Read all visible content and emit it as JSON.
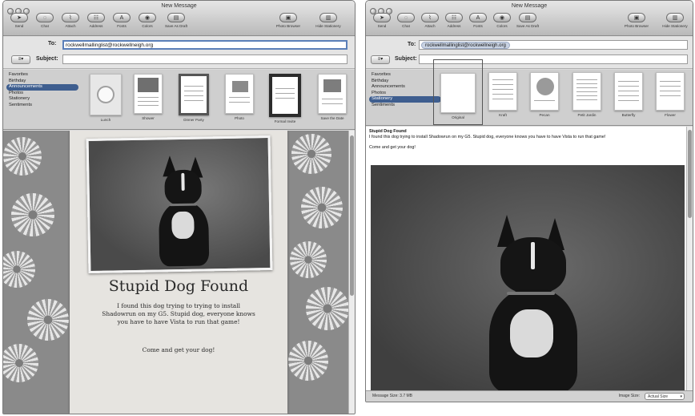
{
  "left": {
    "title": "New Message",
    "toolbar": [
      "Send",
      "Chat",
      "Attach",
      "Address",
      "Fonts",
      "Colors",
      "Save As Draft",
      "Photo Browser",
      "Hide Stationery"
    ],
    "to": "rockwellmallinglist@rockwellneigh.org",
    "to_label": "To:",
    "subject_label": "Subject:",
    "subject": "",
    "categories": [
      "Favorites",
      "Birthday",
      "Announcements",
      "Photos",
      "Stationery",
      "Sentiments"
    ],
    "selected_category": 2,
    "templates": [
      "Lunch",
      "Shower",
      "Dinner Party",
      "Photo",
      "Formal Invite",
      "Save the Date"
    ],
    "letter": {
      "title": "Stupid Dog Found",
      "body": "I found this dog trying to trying to install Shadowrun on my G5. Stupid dog, everyone knows you have to have Vista to run that game!",
      "sign": "Come and get your dog!"
    }
  },
  "right": {
    "title": "New Message",
    "toolbar": [
      "Send",
      "Chat",
      "Attach",
      "Address",
      "Fonts",
      "Colors",
      "Save As Draft",
      "Photo Browser",
      "Hide Stationery"
    ],
    "to": "rockwellmallinglist@rockwellneigh.org",
    "to_label": "To:",
    "subject_label": "Subject:",
    "categories": [
      "Favorites",
      "Birthday",
      "Announcements",
      "Photos",
      "Stationery",
      "Sentiments"
    ],
    "selected_category": 4,
    "templates": [
      "Original",
      "Kraft",
      "Pecan",
      "Petit Jardin",
      "Butterfly",
      "Flower"
    ],
    "body_title": "Stupid Dog Found",
    "body_text": "I found this dog trying to install Shadowrun on my G5. Stupid dog, everyone knows you have to have Vista to run that game!",
    "body_sign": "Come and get your dog!",
    "message_size_label": "Message Size: 3.7 MB",
    "image_size_label": "Image Size:",
    "image_size_value": "Actual Size"
  },
  "colors": {
    "selection": "#3e5e8f",
    "chip": "#c9d3e3",
    "window": "#dcdcdc"
  }
}
